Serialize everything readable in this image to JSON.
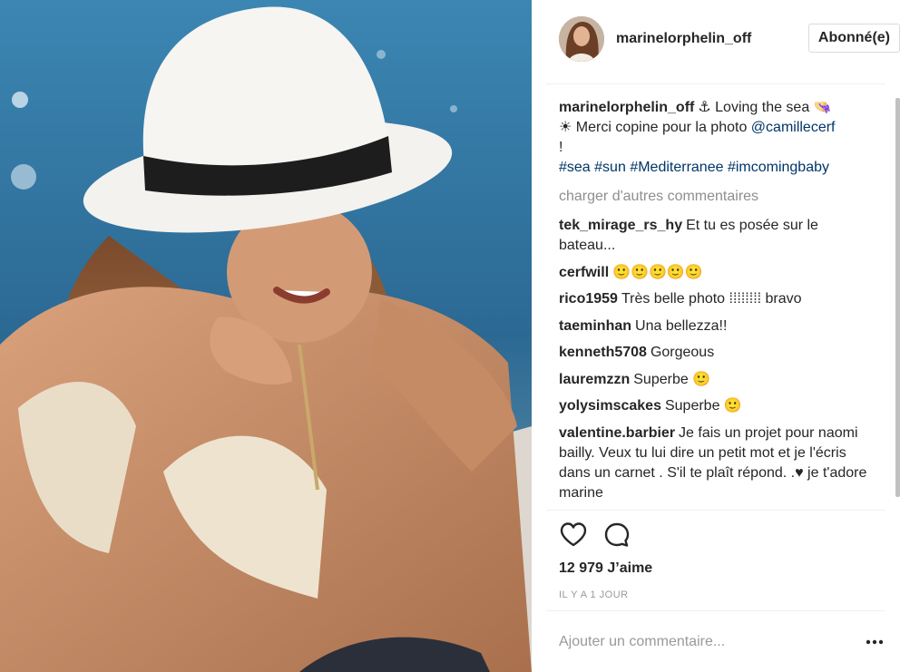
{
  "post": {
    "author": "marinelorphelin_off",
    "follow_label": "Abonné(e)",
    "caption": {
      "username": "marinelorphelin_off",
      "text_1": "⚓ Loving the sea 👒",
      "text_2": "☀ Merci copine pour la photo ",
      "mention": "@camillecerf",
      "text_3": "!",
      "hashtags": [
        "#sea",
        "#sun",
        "#Mediterranee",
        "#imcomingbaby"
      ]
    },
    "load_more_label": "charger d'autres commentaires",
    "comments": [
      {
        "username": "tek_mirage_rs_hy",
        "text": "Et tu es posée sur le bateau..."
      },
      {
        "username": "cerfwill",
        "text": "🙂🙂🙂🙂🙂"
      },
      {
        "username": "rico1959",
        "text": "Très belle photo ⁞⁞⁞⁞⁞⁞⁞⁞ bravo"
      },
      {
        "username": "taeminhan",
        "text": "Una bellezza!!"
      },
      {
        "username": "kenneth5708",
        "text": "Gorgeous"
      },
      {
        "username": "lauremzzn",
        "text": "Superbe 🙂"
      },
      {
        "username": "yolysimscakes",
        "text": "Superbe 🙂"
      },
      {
        "username": "valentine.barbier",
        "text": "Je fais un projet pour naomi bailly. Veux tu lui dire un petit mot et je l'écris dans un carnet . S'il te plaît répond. .♥ je t'adore marine"
      }
    ],
    "likes_label": "12 979 J’aime",
    "timestamp": "IL Y A 1 JOUR",
    "add_comment_placeholder": "Ajouter un commentaire..."
  },
  "icons": {
    "like": "heart-outline-icon",
    "comment": "speech-bubble-icon",
    "more": "ellipsis-icon"
  },
  "colors": {
    "link": "#003569",
    "muted": "#8e8e8e",
    "text": "#262626",
    "border": "#efefef"
  }
}
